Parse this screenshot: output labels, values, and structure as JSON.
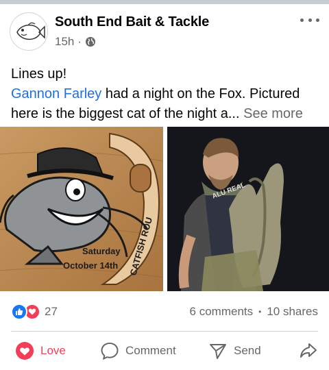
{
  "post": {
    "page_name": "South End Bait & Tackle",
    "time": "15h",
    "separator": "·",
    "audience_icon": "globe-icon",
    "text_line1": "Lines up!",
    "mention": "Gannon Farley",
    "text_line2_rest": " had a night on the Fox. Pictured",
    "text_line3": "here is the biggest cat of the night a...",
    "see_more": " See more"
  },
  "photos": {
    "left": {
      "line1": "Saturday",
      "line2": "October 14th",
      "banner": "CATFISH ROU"
    },
    "right": {
      "shirt_text": "ALU REAL"
    }
  },
  "stats": {
    "reaction_icons": [
      "like-icon",
      "love-icon"
    ],
    "reaction_count": "27",
    "comments": "6 comments",
    "dot": "•",
    "shares": "10 shares"
  },
  "actions": {
    "love_label": "Love",
    "comment_label": "Comment",
    "send_label": "Send",
    "share_icon": "share-icon"
  },
  "colors": {
    "link": "#216fdb",
    "love": "#f33e58",
    "like": "#1877f2",
    "muted": "#65676b"
  }
}
